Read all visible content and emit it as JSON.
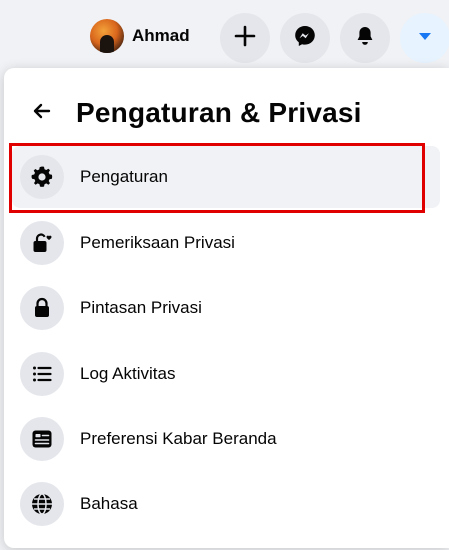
{
  "topbar": {
    "profile_name": "Ahmad",
    "buttons": [
      {
        "icon": "plus-icon"
      },
      {
        "icon": "messenger-icon"
      },
      {
        "icon": "bell-icon"
      },
      {
        "icon": "caret-down-icon",
        "active": true,
        "accent": "#1877f2"
      }
    ]
  },
  "panel": {
    "title": "Pengaturan & Privasi",
    "items": [
      {
        "label": "Pengaturan",
        "icon": "gear-icon",
        "selected": true
      },
      {
        "label": "Pemeriksaan Privasi",
        "icon": "lock-heart-icon"
      },
      {
        "label": "Pintasan Privasi",
        "icon": "lock-icon"
      },
      {
        "label": "Log Aktivitas",
        "icon": "list-icon"
      },
      {
        "label": "Preferensi Kabar Beranda",
        "icon": "feed-icon"
      },
      {
        "label": "Bahasa",
        "icon": "globe-icon"
      }
    ]
  },
  "colors": {
    "highlight": "#e00000",
    "accent": "#1877f2"
  }
}
